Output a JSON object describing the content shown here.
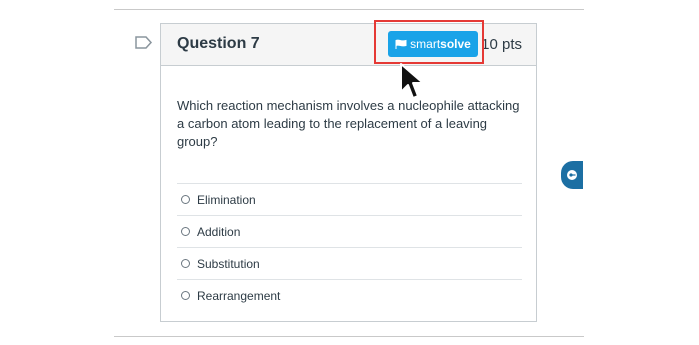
{
  "question": {
    "title": "Question 7",
    "points": "10 pts",
    "text": "Which reaction mechanism involves a nucleophile attacking a carbon atom leading to the replacement of a leaving group?",
    "answers": [
      {
        "label": "Elimination"
      },
      {
        "label": "Addition"
      },
      {
        "label": "Substitution"
      },
      {
        "label": "Rearrangement"
      }
    ]
  },
  "smartsolve": {
    "label_light": "smart",
    "label_bold": "solve",
    "color": "#1aa3e8",
    "highlight_color": "#e53935"
  },
  "side_tab": {
    "icon": "key-icon",
    "color": "#1c6fa3"
  },
  "flag": {
    "icon": "flag-outline-icon"
  }
}
